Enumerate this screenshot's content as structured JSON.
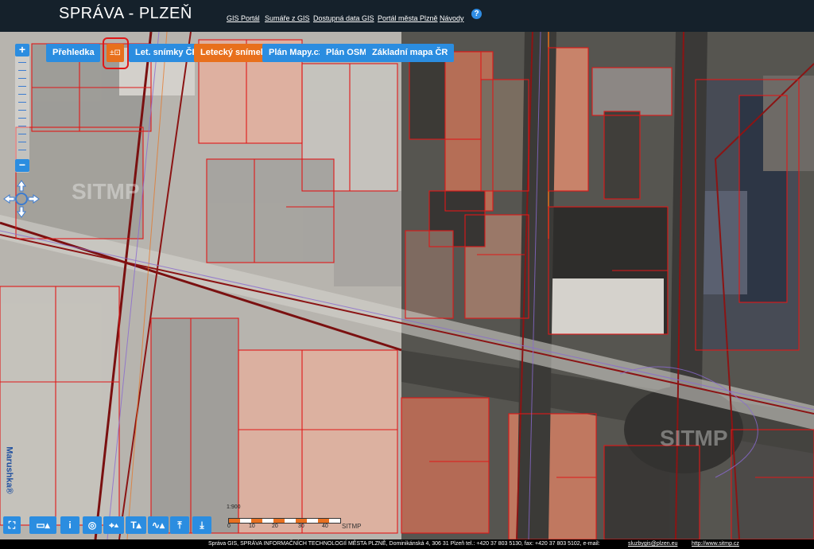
{
  "header": {
    "title": "SPRÁVA - PLZEŇ",
    "links": [
      "GIS Portál",
      "Sumáře z GIS",
      "Dostupná data GIS",
      "Portál města Plzně",
      "Návody"
    ],
    "help_icon": "question-icon"
  },
  "layer_buttons": {
    "overview": "Přehledka",
    "swipe_icon": "layer-swipe-icon",
    "aerial_cr": "Let. snímky ČR",
    "aerial": "Letecký snímek",
    "mapy_cz": "Plán Mapy.cz",
    "osm": "Plán OSM",
    "base_map": "Základní mapa ČR",
    "active": "Letecký snímek"
  },
  "zoom": {
    "plus": "+",
    "minus": "−"
  },
  "side_label": "Marushka®",
  "tools": [
    "measure-icon",
    "info-icon",
    "location-icon",
    "gps-icon",
    "text-tool-icon",
    "profile-icon",
    "upload-icon",
    "download-icon"
  ],
  "scale": {
    "title": "1:900",
    "ticks": [
      "0",
      "10",
      "20",
      "30",
      "40"
    ],
    "logo": "SITMP"
  },
  "watermarks": [
    "SITMP",
    "SITMP"
  ],
  "footer": {
    "text": "Správa GIS, SPRÁVA INFORMAČNÍCH TECHNOLOGIÍ MĚSTA PLZNĚ, Dominikánská 4, 306 31 Plzeň tel.: +420 37 803 5130, fax: +420 37 803 5102, e-mail:",
    "email": "sluzbygis@plzen.eu",
    "url": "http://www.sitmp.cz"
  },
  "colors": {
    "header_bg": "#15212b",
    "button_blue": "#2b8de0",
    "button_orange": "#e8701c",
    "parcel_red": "#e01818"
  }
}
